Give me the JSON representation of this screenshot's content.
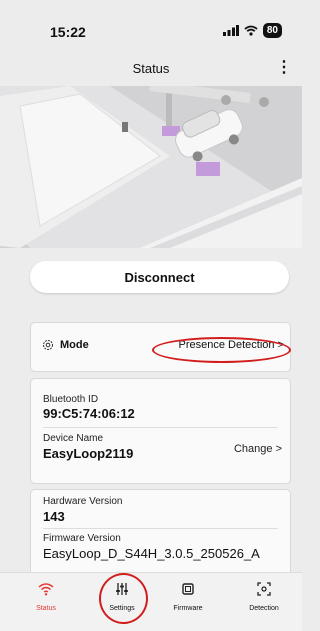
{
  "status_bar": {
    "time": "15:22",
    "battery": "80"
  },
  "header": {
    "title": "Status",
    "more_icon": "more-vertical-icon"
  },
  "disconnect_label": "Disconnect",
  "mode": {
    "label": "Mode",
    "value": "Presence Detection >",
    "icon": "gear-icon"
  },
  "device": {
    "bluetooth_label": "Bluetooth ID",
    "bluetooth_value": "99:C5:74:06:12",
    "name_label": "Device Name",
    "name_value": "EasyLoop2119",
    "change_label": "Change >"
  },
  "versions": {
    "hardware_label": "Hardware Version",
    "hardware_value": "143",
    "firmware_label": "Firmware Version",
    "firmware_value": "EasyLoop_D_S44H_3.0.5_250526_A"
  },
  "tabs": [
    {
      "label": "Status",
      "icon": "wifi-icon",
      "active": true
    },
    {
      "label": "Settings",
      "icon": "sliders-icon",
      "active": false
    },
    {
      "label": "Firmware",
      "icon": "chip-icon",
      "active": false
    },
    {
      "label": "Detection",
      "icon": "sensor-icon",
      "active": false
    }
  ],
  "colors": {
    "accent": "#e53935",
    "annotation": "#d21d1d"
  }
}
